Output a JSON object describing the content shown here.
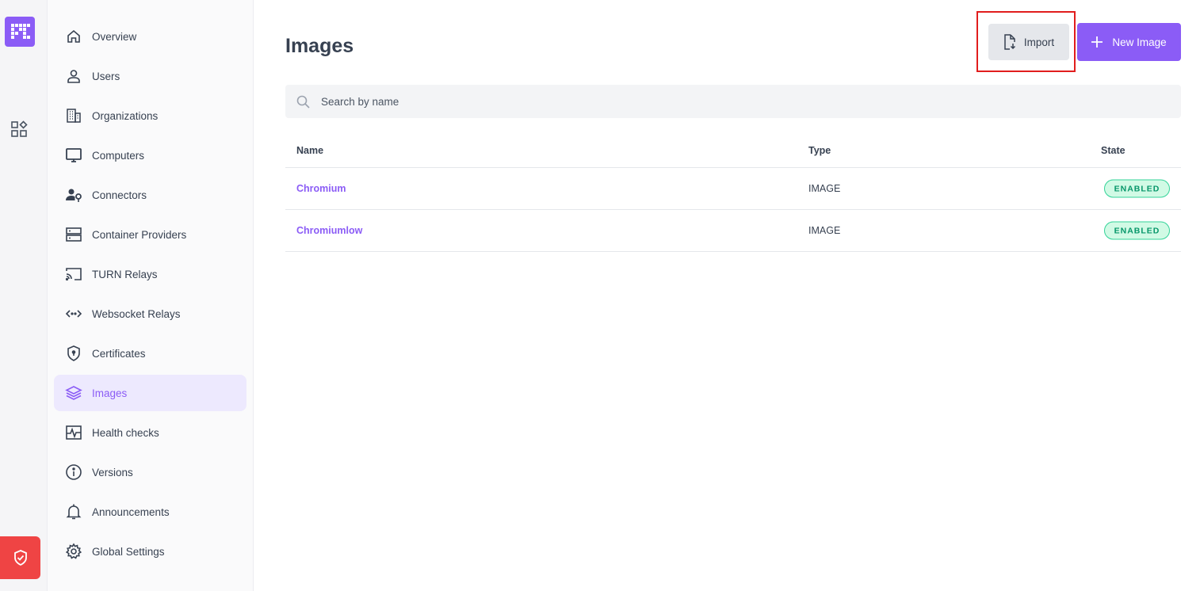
{
  "nav": {
    "items": [
      {
        "label": "Overview",
        "icon": "home-icon",
        "active": false
      },
      {
        "label": "Users",
        "icon": "user-icon",
        "active": false
      },
      {
        "label": "Organizations",
        "icon": "building-icon",
        "active": false
      },
      {
        "label": "Computers",
        "icon": "monitor-icon",
        "active": false
      },
      {
        "label": "Connectors",
        "icon": "user-key-icon",
        "active": false
      },
      {
        "label": "Container Providers",
        "icon": "server-icon",
        "active": false
      },
      {
        "label": "TURN Relays",
        "icon": "cast-icon",
        "active": false
      },
      {
        "label": "Websocket Relays",
        "icon": "code-icon",
        "active": false
      },
      {
        "label": "Certificates",
        "icon": "shield-icon",
        "active": false
      },
      {
        "label": "Images",
        "icon": "layers-icon",
        "active": true
      },
      {
        "label": "Health checks",
        "icon": "pulse-icon",
        "active": false
      },
      {
        "label": "Versions",
        "icon": "info-icon",
        "active": false
      },
      {
        "label": "Announcements",
        "icon": "bell-icon",
        "active": false
      },
      {
        "label": "Global Settings",
        "icon": "gear-icon",
        "active": false
      }
    ]
  },
  "page": {
    "title": "Images",
    "import_label": "Import",
    "new_label": "New Image"
  },
  "search": {
    "placeholder": "Search by name"
  },
  "table": {
    "headers": {
      "name": "Name",
      "type": "Type",
      "state": "State"
    },
    "rows": [
      {
        "name": "Chromium",
        "type": "IMAGE",
        "state": "ENABLED"
      },
      {
        "name": "Chromiumlow",
        "type": "IMAGE",
        "state": "ENABLED"
      }
    ]
  },
  "colors": {
    "accent": "#8b5cf6",
    "danger": "#ef4444",
    "enabled": "#059669"
  }
}
